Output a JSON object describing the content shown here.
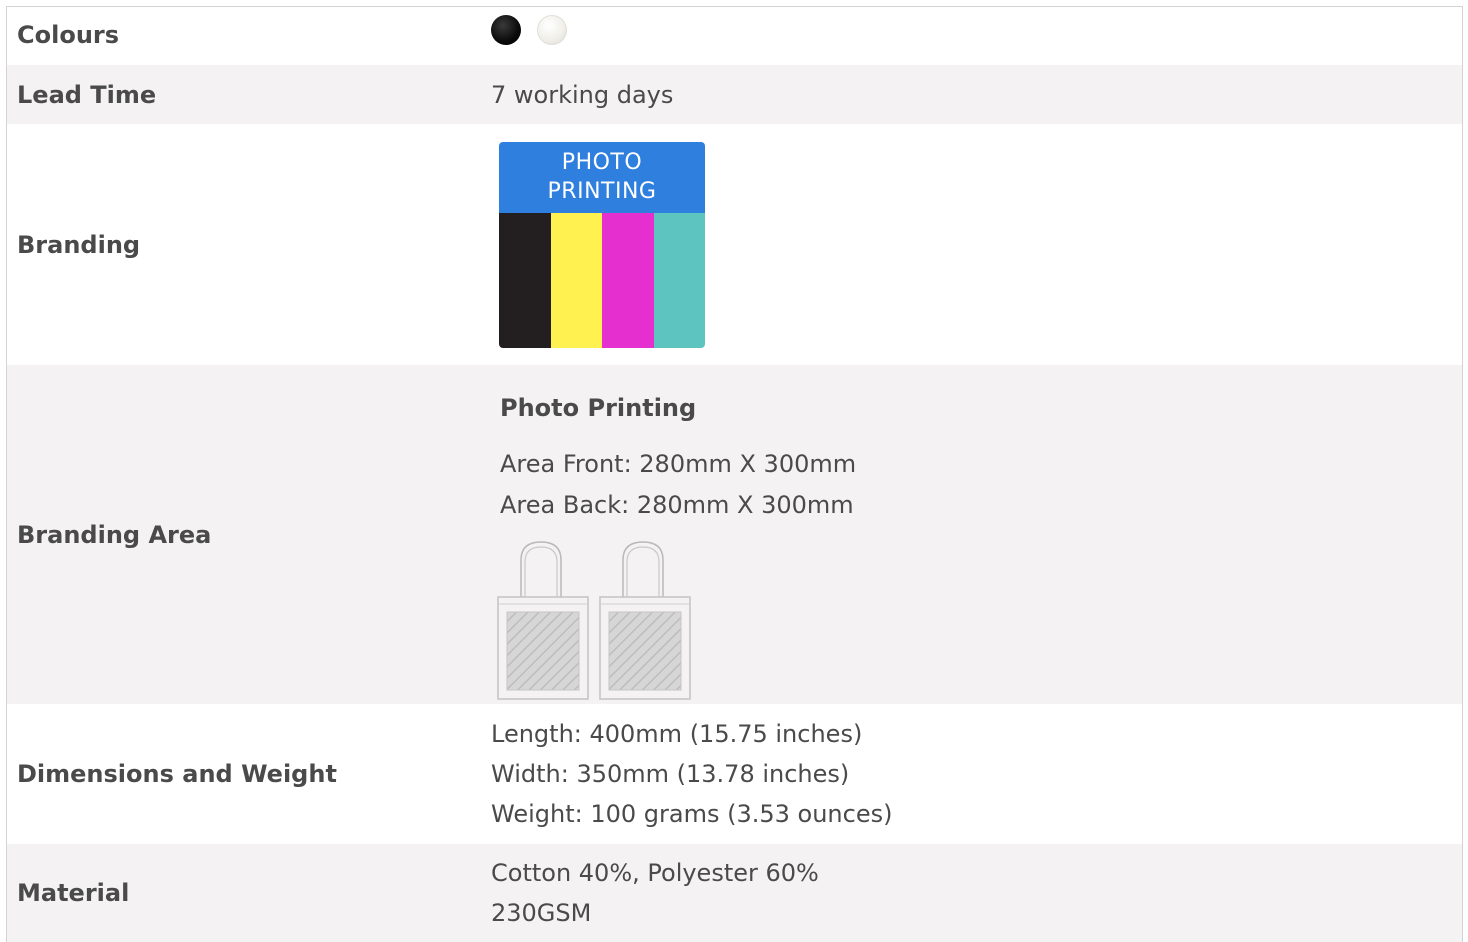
{
  "rows": {
    "colours": {
      "label": "Colours",
      "swatches": [
        "#0a0a0a",
        "#f0efe9"
      ]
    },
    "lead_time": {
      "label": "Lead Time",
      "value": "7 working days"
    },
    "branding": {
      "label": "Branding",
      "badge": {
        "title": "PHOTO\nPRINTING",
        "header_color": "#2f7fde",
        "bar_colors": [
          "#231f20",
          "#fff150",
          "#e52fce",
          "#5dc4bf"
        ]
      }
    },
    "branding_area": {
      "label": "Branding Area",
      "title": "Photo Printing",
      "lines": [
        "Area Front: 280mm X 300mm",
        "Area Back: 280mm X 300mm"
      ],
      "images": [
        "tote-bag-front-icon",
        "tote-bag-back-icon"
      ]
    },
    "dimensions": {
      "label": "Dimensions and Weight",
      "lines": [
        "Length: 400mm (15.75 inches)",
        "Width: 350mm (13.78 inches)",
        "Weight: 100 grams (3.53 ounces)"
      ]
    },
    "material": {
      "label": "Material",
      "lines": [
        "Cotton 40%, Polyester 60%",
        "230GSM"
      ]
    }
  }
}
